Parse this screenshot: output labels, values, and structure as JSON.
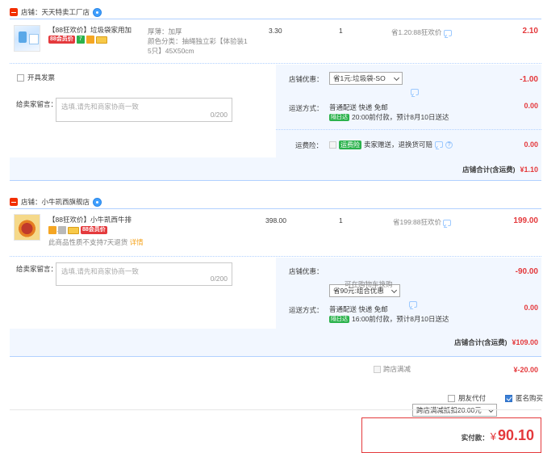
{
  "shops": [
    {
      "name": "店铺：天天特卖工厂店",
      "item": {
        "title": "【88狂欢价】垃圾袋家用加厚...",
        "badge_88": "88会员价",
        "badge_7": "7",
        "attr1": "厚薄：加厚",
        "attr2": "颜色分类：抽绳独立彩【体验装1",
        "attr3": "5只】45X50cm",
        "price": "3.30",
        "qty": "1",
        "promo": "省1.20:88狂欢价",
        "subtotal": "2.10"
      },
      "invoice_label": "开具发票",
      "message_label": "给卖家留言：",
      "message_placeholder": "选填,请先和商家协商一致",
      "message_counter": "0/200",
      "discount_label": "店铺优惠：",
      "discount_value": "省1元:垃圾袋-SO",
      "discount_amount": "-1.00",
      "shipping_label": "运送方式：",
      "shipping_desc": "普通配送 快递 免邮",
      "shipping_tag": "隔日达",
      "shipping_time": "20:00前付款，预计8月10日送达",
      "shipping_fee": "0.00",
      "insurance_label": "运费险：",
      "insurance_tag": "运费险",
      "insurance_desc": "卖家赠送，退换货可赔",
      "insurance_fee": "0.00",
      "total_label": "店铺合计(含运费)",
      "total_value": "¥1.10"
    },
    {
      "name": "店铺：小牛凯西旗舰店",
      "item": {
        "title": "【88狂欢价】小牛凯西牛排进...",
        "badge_88": "88会员价",
        "notice": "此商品性质不支持7天退货",
        "notice_link": "详情",
        "price": "398.00",
        "qty": "1",
        "promo": "省199:88狂欢价",
        "subtotal": "199.00"
      },
      "message_label": "给卖家留言：",
      "message_placeholder": "选填,请先和商家协商一致",
      "message_counter": "0/200",
      "discount_label": "店铺优惠：",
      "discount_value": "省90元:组合优惠",
      "discount_note": "可在购物车换购",
      "discount_amount": "-90.00",
      "shipping_label": "运送方式：",
      "shipping_desc": "普通配送 快递 免邮",
      "shipping_tag": "隔日达",
      "shipping_time": "16:00前付款，预计8月10日送达",
      "shipping_fee": "0.00",
      "total_label": "店铺合计(含运费)",
      "total_value": "¥109.00"
    }
  ],
  "cross_discount": {
    "label": "跨店满减",
    "select": "跨店满减抵扣20.00元",
    "amount": "¥-20.00"
  },
  "options": {
    "friend_pay": "朋友代付",
    "anonymous": "匿名购买"
  },
  "payment": {
    "label": "实付款：",
    "currency": "¥",
    "amount": "90.10"
  },
  "colors": {
    "accent_red": "#e4393c",
    "panel_bg": "#f2f7ff",
    "border_blue": "#b2d1ff"
  }
}
